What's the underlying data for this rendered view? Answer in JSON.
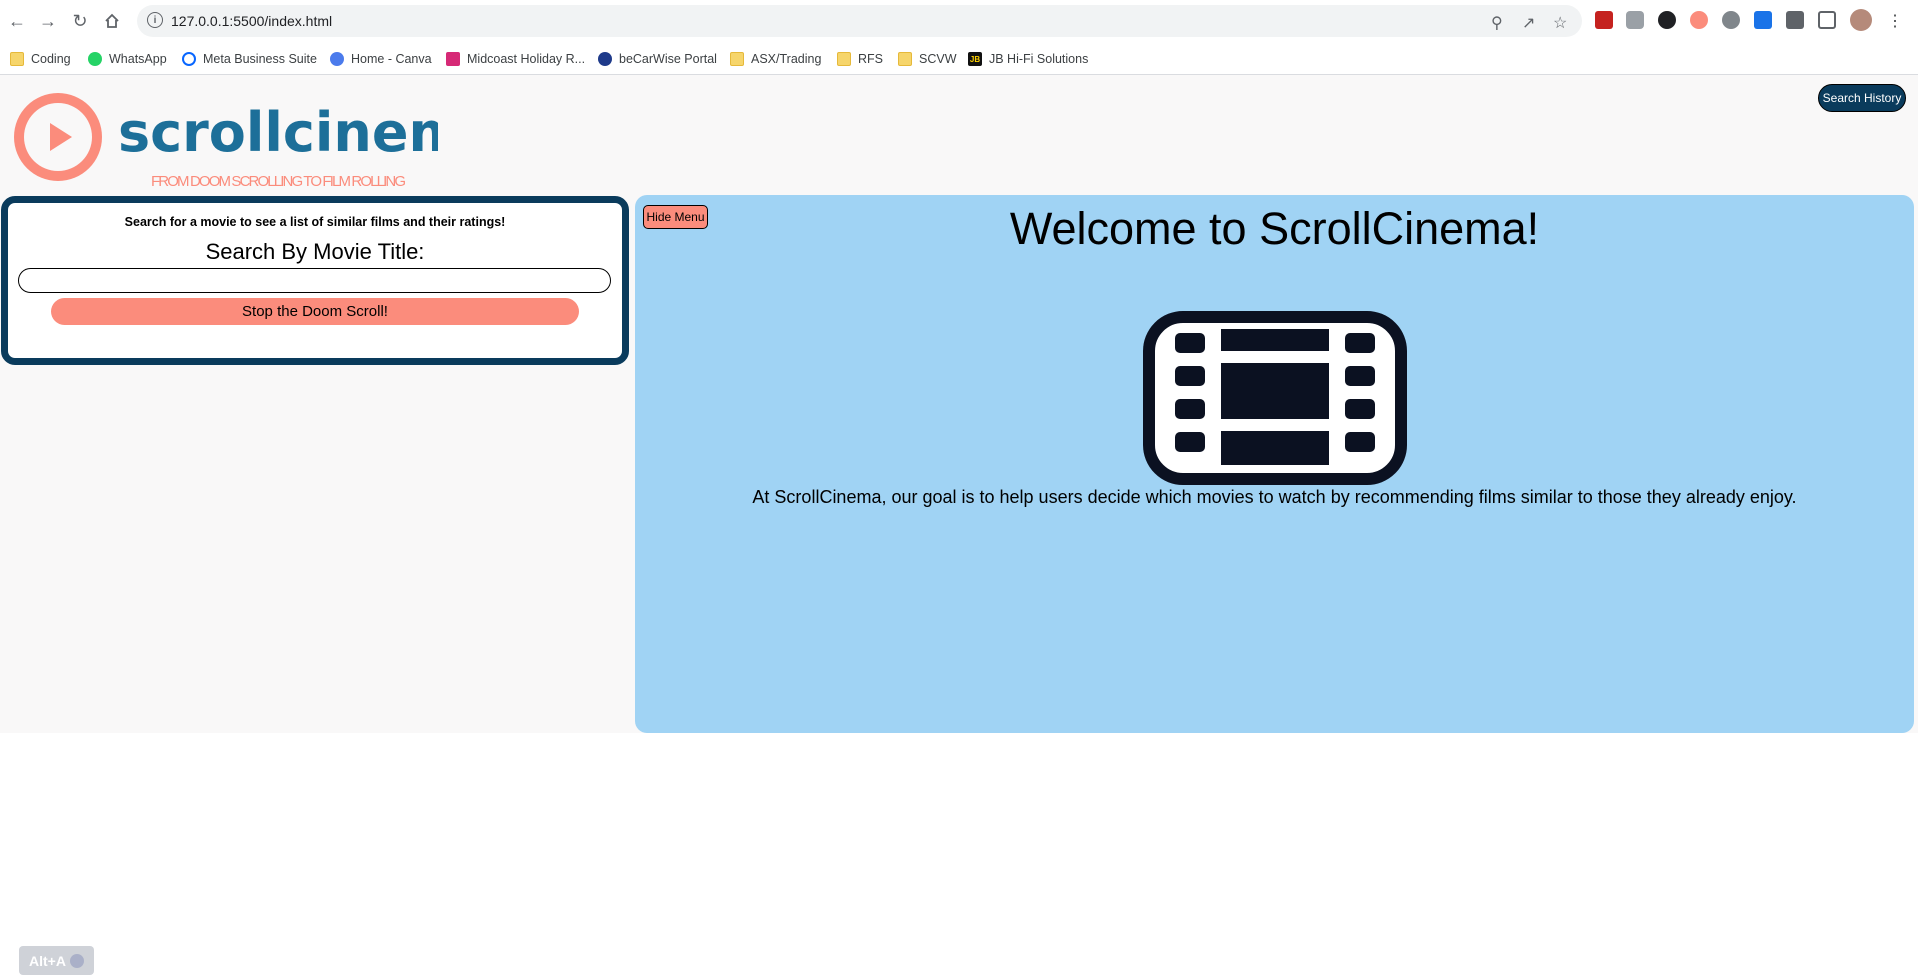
{
  "browser": {
    "url": "127.0.0.1:5500/index.html",
    "bookmarks": [
      {
        "label": "Coding",
        "icon": "folder-icon"
      },
      {
        "label": "WhatsApp",
        "icon": "whatsapp-icon"
      },
      {
        "label": "Meta Business Suite",
        "icon": "meta-icon"
      },
      {
        "label": "Home - Canva",
        "icon": "canva-icon"
      },
      {
        "label": "Midcoast Holiday R...",
        "icon": "instagram-icon"
      },
      {
        "label": "beCarWise Portal",
        "icon": "becarwise-icon"
      },
      {
        "label": "ASX/Trading",
        "icon": "folder-icon"
      },
      {
        "label": "RFS",
        "icon": "folder-icon"
      },
      {
        "label": "SCVW",
        "icon": "folder-icon"
      },
      {
        "label": "JB Hi-Fi Solutions",
        "icon": "jb-hifi-icon"
      }
    ],
    "jb_badge": "JB"
  },
  "header": {
    "logo_name": "scrollcinema",
    "logo_tagline": "FROM DOOM SCROLLING TO FILM ROLLING",
    "history_button": "Search History"
  },
  "search": {
    "hint": "Search for a movie to see a list of similar films and their ratings!",
    "title": "Search By Movie Title:",
    "input_value": "",
    "button": "Stop the Doom Scroll!"
  },
  "main": {
    "hide_menu_button": "Hide Menu",
    "title": "Welcome to ScrollCinema!",
    "description": "At ScrollCinema, our goal is to help users decide which movies to watch by recommending films similar to those they already enjoy."
  },
  "overlay": {
    "shortcut_label": "Alt+A"
  },
  "colors": {
    "accent_coral": "#fb8c7c",
    "navy": "#0a3b5c",
    "panel_blue": "#a0d3f4",
    "logo_teal": "#1d6f99"
  }
}
